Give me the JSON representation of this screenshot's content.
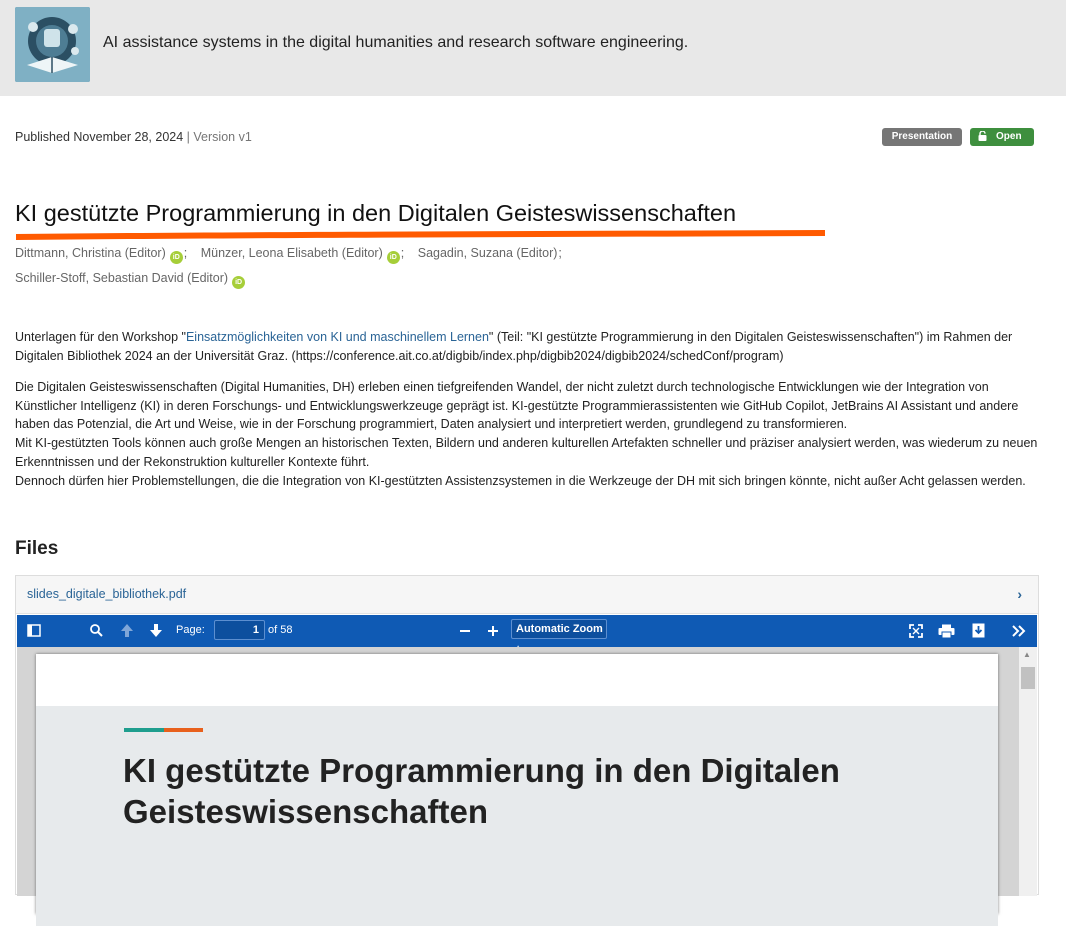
{
  "header": {
    "community_title": "AI assistance systems in the digital humanities and research software engineering."
  },
  "record": {
    "published_prefix": "Published",
    "published_date": "November 28, 2024",
    "separator": "|",
    "version": "Version v1",
    "type_badge": "Presentation",
    "access_badge": "Open",
    "title": "KI gestützte Programmierung in den Digitalen Geisteswissenschaften",
    "creators": [
      {
        "name": "Dittmann, Christina (Editor)",
        "orcid": true
      },
      {
        "name": "Münzer, Leona Elisabeth (Editor)",
        "orcid": true
      },
      {
        "name": "Sagadin, Suzana (Editor)",
        "orcid": false
      },
      {
        "name": "Schiller-Stoff, Sebastian David (Editor)",
        "orcid": true
      }
    ],
    "orcid_label": "iD",
    "description": {
      "p1_prefix": "Unterlagen für den Workshop \"",
      "p1_link": "Einsatzmöglichkeiten von KI und maschinellem Lernen",
      "p1_suffix": "\" (Teil: \"KI gestützte Programmierung in den Digitalen Geisteswissenschaften\") im Rahmen der Digitalen Bibliothek 2024 an der Universität Graz. (https://conference.ait.co.at/digbib/index.php/digbib2024/digbib2024/schedConf/program)",
      "p2_line1": "Die Digitalen Geisteswissenschaften (Digital Humanities, DH) erleben einen tiefgreifenden Wandel, der nicht zuletzt durch technologische Entwicklungen wie der Integration von Künstlicher Intelligenz (KI) in deren Forschungs- und Entwicklungswerkzeuge geprägt ist. KI-gestützte Programmierassistenten wie GitHub Copilot, JetBrains AI Assistant und andere haben das Potenzial, die Art und Weise, wie in der Forschung programmiert, Daten analysiert und interpretiert werden, grundlegend zu transformieren.",
      "p2_line2": "Mit KI-gestützten Tools können auch große Mengen an historischen Texten, Bildern und anderen kulturellen Artefakten schneller und präziser analysiert werden, was wiederum zu neuen Erkenntnissen und der Rekonstruktion kultureller Kontexte führt.",
      "p2_line3": "Dennoch dürfen hier Problemstellungen, die die Integration von KI-gestützten Assistenzsystemen in die Werkzeuge der DH mit sich bringen könnte, nicht außer Acht gelassen werden."
    }
  },
  "files": {
    "heading": "Files",
    "filename": "slides_digitale_bibliothek.pdf",
    "viewer": {
      "page_label": "Page:",
      "page_value": "1",
      "page_of": "of 58",
      "zoom_value": "Automatic Zoom",
      "slide_title": "KI gestützte Programmierung in den Digitalen Geisteswissenschaften"
    }
  },
  "colors": {
    "title_underline": "#ff5a00",
    "toolbar": "#0f5ab4",
    "open_badge": "#3e8f3e",
    "type_badge": "#767676",
    "link": "#2a6496",
    "orcid": "#a6ce39"
  },
  "icons": [
    "community-logo",
    "lock-icon",
    "orcid-icon",
    "chevron-right-icon",
    "sidebar-toggle-icon",
    "search-icon",
    "arrow-up-icon",
    "arrow-down-icon",
    "zoom-out-icon",
    "zoom-in-icon",
    "fullscreen-icon",
    "print-icon",
    "download-icon",
    "more-tools-icon"
  ]
}
